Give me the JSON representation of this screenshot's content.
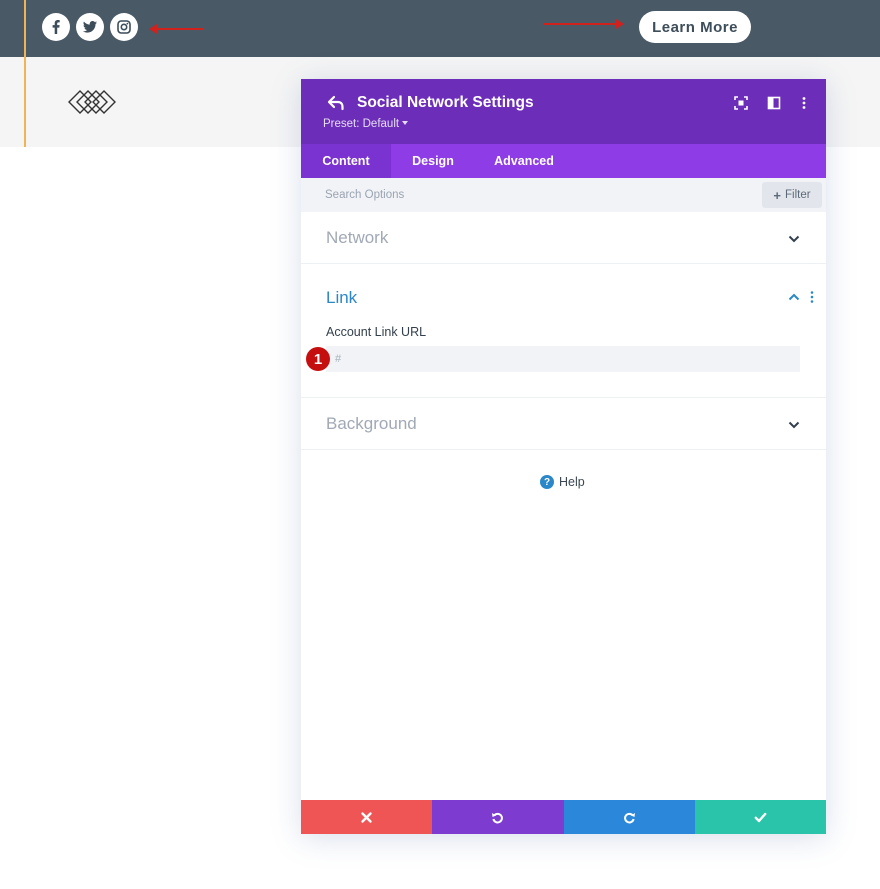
{
  "colors": {
    "topbar": "#495965",
    "header_strip": "#f5f5f5",
    "accent_line": "#f0b455",
    "modal_header": "#6c2eb9",
    "tabs_bg": "#8d3ce6",
    "active_tab": "#7a33d0",
    "link_blue": "#2b87c8",
    "badge_red": "#c50f0f",
    "cancel": "#ef5555",
    "undo": "#7d3bcf",
    "redo": "#2b87da",
    "save": "#29c4a9"
  },
  "topbar": {
    "social_icons": [
      "facebook-icon",
      "twitter-icon",
      "instagram-icon"
    ],
    "learn_more_label": "Learn More"
  },
  "modal": {
    "title": "Social Network Settings",
    "preset": "Preset: Default",
    "tabs": [
      {
        "label": "Content",
        "active": true
      },
      {
        "label": "Design",
        "active": false
      },
      {
        "label": "Advanced",
        "active": false
      }
    ],
    "search": {
      "placeholder": "Search Options",
      "value": ""
    },
    "filter_label": "Filter",
    "sections": [
      {
        "title": "Network",
        "expanded": false
      },
      {
        "title": "Link",
        "expanded": true
      },
      {
        "title": "Background",
        "expanded": false
      }
    ],
    "link_field": {
      "label": "Account Link URL",
      "placeholder": "#",
      "value": "",
      "badge": "1"
    },
    "help_label": "Help",
    "footer_buttons": [
      "cancel-icon",
      "undo-icon",
      "redo-icon",
      "save-check-icon"
    ]
  }
}
